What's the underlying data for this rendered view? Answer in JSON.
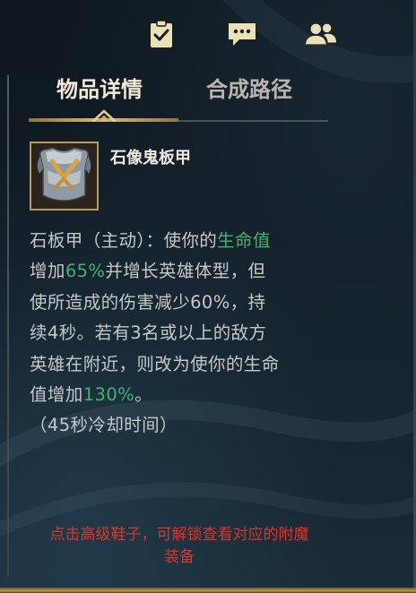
{
  "header": {
    "icons": [
      {
        "name": "clipboard-check-icon"
      },
      {
        "name": "chat-icon"
      },
      {
        "name": "friends-icon"
      }
    ]
  },
  "tabs": [
    {
      "label": "物品详情",
      "active": true
    },
    {
      "label": "合成路径",
      "active": false
    }
  ],
  "item": {
    "name": "石像鬼板甲",
    "icon": "armor-plate-icon"
  },
  "description": {
    "line1_a": "石板甲（主动）：使你的",
    "line1_b": "生命值",
    "line2_a": "增加",
    "line2_b": "65%",
    "line2_c": "并增长英雄体型，但",
    "line3": "使所造成的伤害减少60%，持",
    "line4": "续4秒。若有3名或以上的敌方",
    "line5": "英雄在附近，则改为使你的生命",
    "line6_a": "值增加",
    "line6_b": "130%",
    "line6_c": "。",
    "line7": "（45秒冷却时间）"
  },
  "hint": {
    "line1": "点击高级鞋子，可解锁查看对应的附魔",
    "line2": "装备"
  },
  "colors": {
    "accent_gold": "#d8bd78",
    "highlight_green": "#3fb56b",
    "hint_red": "#d9362c",
    "icon_cream": "#ece0b5"
  }
}
